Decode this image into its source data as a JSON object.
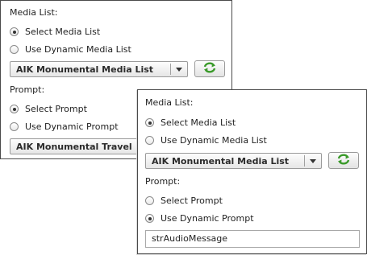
{
  "back_panel": {
    "media_list_label": "Media List:",
    "select_media_list": "Select Media List",
    "use_dynamic_media_list": "Use Dynamic Media List",
    "media_list_dropdown_value": "AIK Monumental Media List",
    "prompt_label": "Prompt:",
    "select_prompt": "Select Prompt",
    "use_dynamic_prompt": "Use Dynamic Prompt",
    "prompt_dropdown_value": "AIK Monumental Travel",
    "media_selected": "select",
    "prompt_selected": "select"
  },
  "front_panel": {
    "media_list_label": "Media List:",
    "select_media_list": "Select Media List",
    "use_dynamic_media_list": "Use Dynamic Media List",
    "media_list_dropdown_value": "AIK Monumental Media List",
    "prompt_label": "Prompt:",
    "select_prompt": "Select Prompt",
    "use_dynamic_prompt": "Use Dynamic Prompt",
    "dynamic_prompt_value": "strAudioMessage",
    "media_selected": "select",
    "prompt_selected": "dynamic"
  },
  "icons": {
    "dropdown_arrow": "chevron-down-icon",
    "refresh": "refresh-icon"
  },
  "colors": {
    "refresh_green": "#3a9a2a",
    "border": "#4a4a4a"
  }
}
